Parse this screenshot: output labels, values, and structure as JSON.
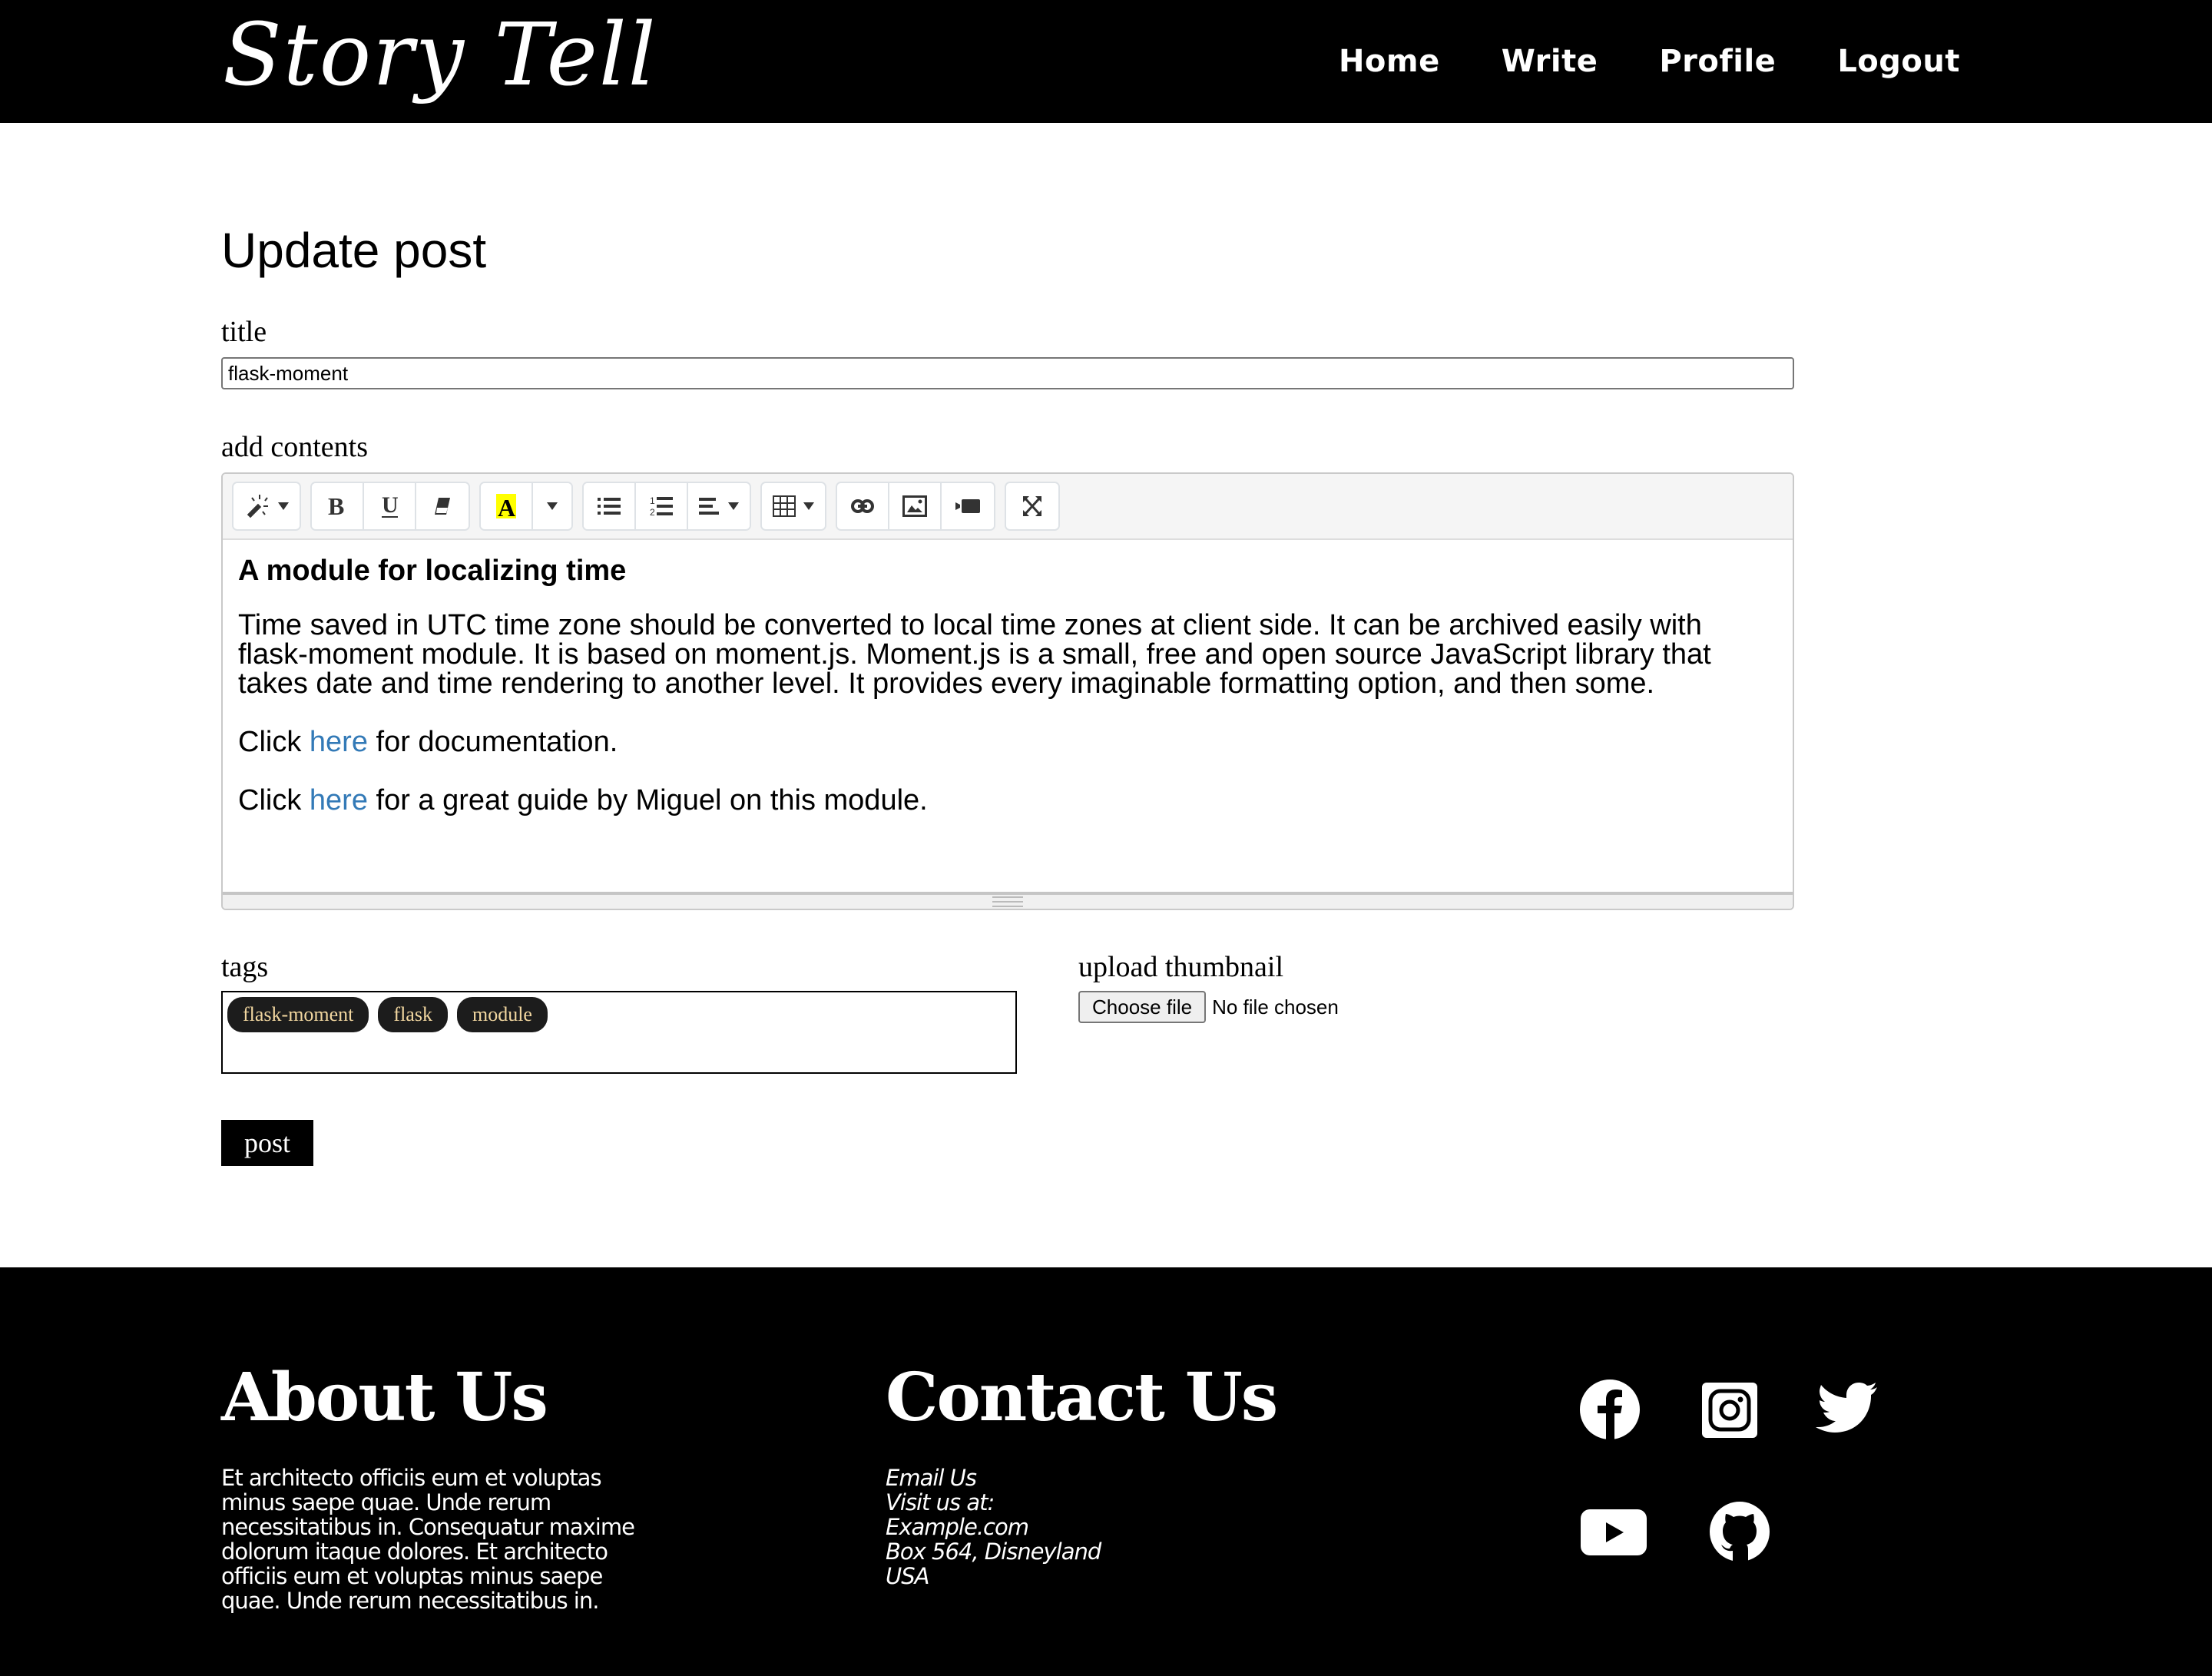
{
  "header": {
    "logo": "Story Tell",
    "nav": [
      "Home",
      "Write",
      "Profile",
      "Logout"
    ]
  },
  "page": {
    "title": "Update post",
    "title_label": "title",
    "title_value": "flask-moment",
    "contents_label": "add contents",
    "editor": {
      "toolbar": [
        {
          "group": "style",
          "buttons": [
            "magic-icon"
          ]
        },
        {
          "group": "font",
          "buttons": [
            "bold-icon",
            "underline-icon",
            "eraser-icon"
          ]
        },
        {
          "group": "color",
          "buttons": [
            "text-color-icon",
            "color-dropdown"
          ]
        },
        {
          "group": "para",
          "buttons": [
            "unordered-list-icon",
            "ordered-list-icon",
            "align-icon"
          ]
        },
        {
          "group": "table",
          "buttons": [
            "table-icon"
          ]
        },
        {
          "group": "insert",
          "buttons": [
            "link-icon",
            "picture-icon",
            "video-icon"
          ]
        },
        {
          "group": "view",
          "buttons": [
            "fullscreen-icon"
          ]
        }
      ],
      "highlight_color": "#ffff00",
      "heading": "A module for localizing time",
      "paragraph": "Time saved in UTC time zone should be converted to local time zones at client side. It can be archived easily with flask-moment module. It is based on moment.js. Moment.js is a small, free and open source JavaScript library that takes date and time rendering to another level. It provides every imaginable formatting option, and then some.",
      "line1_before": "Click ",
      "line1_link": "here",
      "line1_after": " for documentation.",
      "line2_before": "Click ",
      "line2_link": "here",
      "line2_after": " for a great guide by Miguel on this module.",
      "link_color": "#337ab7"
    },
    "tags_label": "tags",
    "tags": [
      "flask-moment",
      "flask",
      "module"
    ],
    "thumbnail_label": "upload thumbnail",
    "file_button": "Choose file",
    "file_status": "No file chosen",
    "post_button": "post"
  },
  "footer": {
    "about_heading": "About Us",
    "about_text": "Et architecto officiis eum et voluptas minus saepe quae. Unde rerum necessitatibus in. Consequatur maxime dolorum itaque dolores. Et architecto officiis eum et voluptas minus saepe quae. Unde rerum necessitatibus in.",
    "contact_heading": "Contact Us",
    "contact_lines": [
      "Email Us",
      "Visit us at:",
      "Example.com",
      "Box 564, Disneyland",
      "USA"
    ],
    "social": [
      "facebook",
      "instagram",
      "twitter",
      "youtube",
      "github"
    ]
  }
}
